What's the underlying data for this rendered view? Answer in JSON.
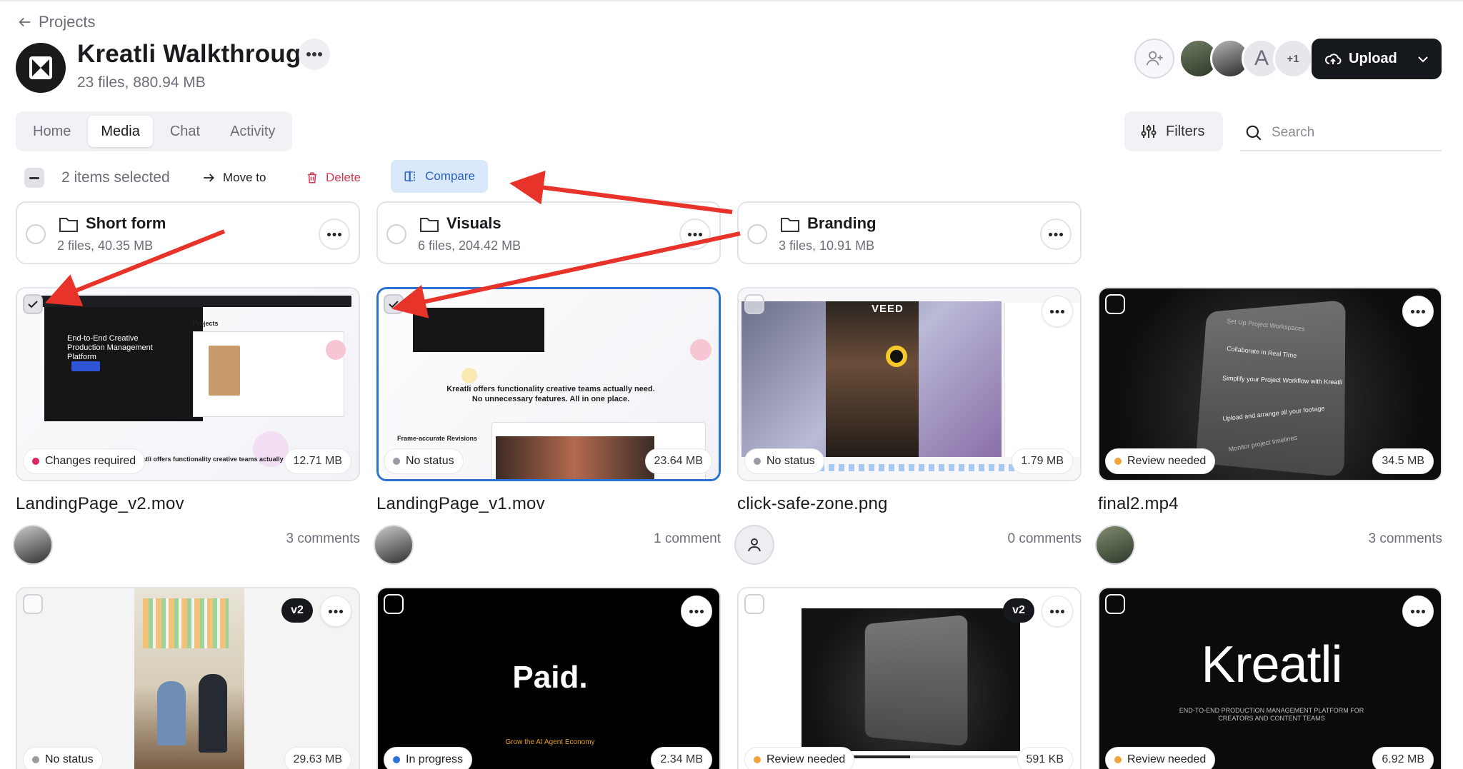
{
  "header": {
    "back_label": "Projects",
    "title": "Kreatli Walkthrough",
    "subtitle": "23 files, 880.94 MB",
    "extra_members": "+1",
    "member_initial": "A",
    "upload_label": "Upload"
  },
  "tabs": [
    {
      "label": "Home"
    },
    {
      "label": "Media"
    },
    {
      "label": "Chat"
    },
    {
      "label": "Activity"
    }
  ],
  "toolbar": {
    "filters_label": "Filters",
    "search_placeholder": "Search",
    "selected_text": "2 items selected",
    "move_label": "Move to",
    "delete_label": "Delete",
    "compare_label": "Compare"
  },
  "folders": [
    {
      "name": "Short form",
      "meta": "2 files, 40.35 MB"
    },
    {
      "name": "Visuals",
      "meta": "6 files, 204.42 MB"
    },
    {
      "name": "Branding",
      "meta": "3 files, 10.91 MB"
    }
  ],
  "files": [
    {
      "name": "LandingPage_v2.mov",
      "status": "Changes required",
      "size": "12.71 MB",
      "comments": "3 comments"
    },
    {
      "name": "LandingPage_v1.mov",
      "status": "No status",
      "size": "23.64 MB",
      "comments": "1 comment"
    },
    {
      "name": "click-safe-zone.png",
      "status": "No status",
      "size": "1.79 MB",
      "comments": "0 comments"
    },
    {
      "name": "final2.mp4",
      "status": "Review needed",
      "size": "34.5 MB",
      "comments": "3 comments"
    },
    {
      "name": "",
      "status": "No status",
      "size": "29.63 MB",
      "version": "v2"
    },
    {
      "name": "",
      "status": "In progress",
      "size": "2.34 MB"
    },
    {
      "name": "",
      "status": "Review needed",
      "size": "591 KB",
      "version": "v2"
    },
    {
      "name": "",
      "status": "Review needed",
      "size": "6.92 MB"
    }
  ],
  "thumb_text": {
    "hero": "End-to-End Creative Production Management Platform",
    "projects": "Projects",
    "tagline": "Kreatli offers functionality creative teams actually need.",
    "tagline2": "No unnecessary features. All in one place.",
    "frame": "Frame-accurate Revisions",
    "veed": "VEED",
    "paid": "Paid.",
    "paid_sub": "Grow the AI Agent Economy",
    "brand": "Kreatli",
    "brand_sub": "END-TO-END PRODUCTION MANAGEMENT PLATFORM FOR CREATORS AND CONTENT TEAMS",
    "steps": [
      "Set Up Project Workspaces",
      "Collaborate in Real Time",
      "Simplify your Project Workflow with Kreatli",
      "Upload and arrange all your footage",
      "Monitor project timelines"
    ]
  },
  "colors": {
    "changes_required": "#e0245e",
    "no_status": "#9a9ca3",
    "review_needed": "#f2a33a",
    "in_progress": "#2b72d6",
    "annotation_arrow": "#e8332a",
    "selected_border": "#2b72d6"
  }
}
